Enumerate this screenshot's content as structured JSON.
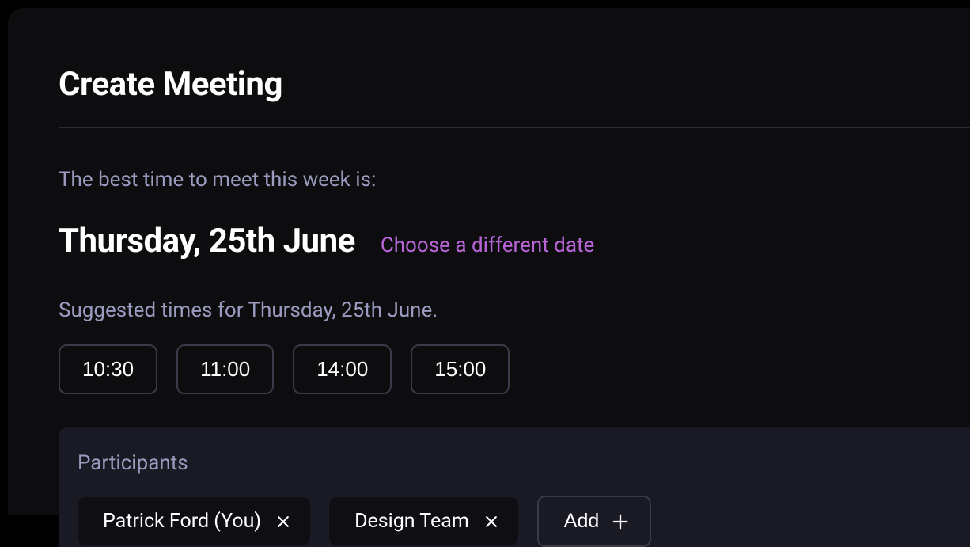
{
  "header": {
    "title": "Create Meeting"
  },
  "best_time": {
    "subtitle": "The best time to meet this week is:",
    "date": "Thursday, 25th June",
    "change_link": "Choose a different date"
  },
  "suggested": {
    "label": "Suggested times for Thursday, 25th June.",
    "times": [
      "10:30",
      "11:00",
      "14:00",
      "15:00"
    ]
  },
  "participants": {
    "label": "Participants",
    "chips": [
      {
        "name": "Patrick Ford (You)"
      },
      {
        "name": "Design Team"
      }
    ],
    "add_label": "Add"
  }
}
